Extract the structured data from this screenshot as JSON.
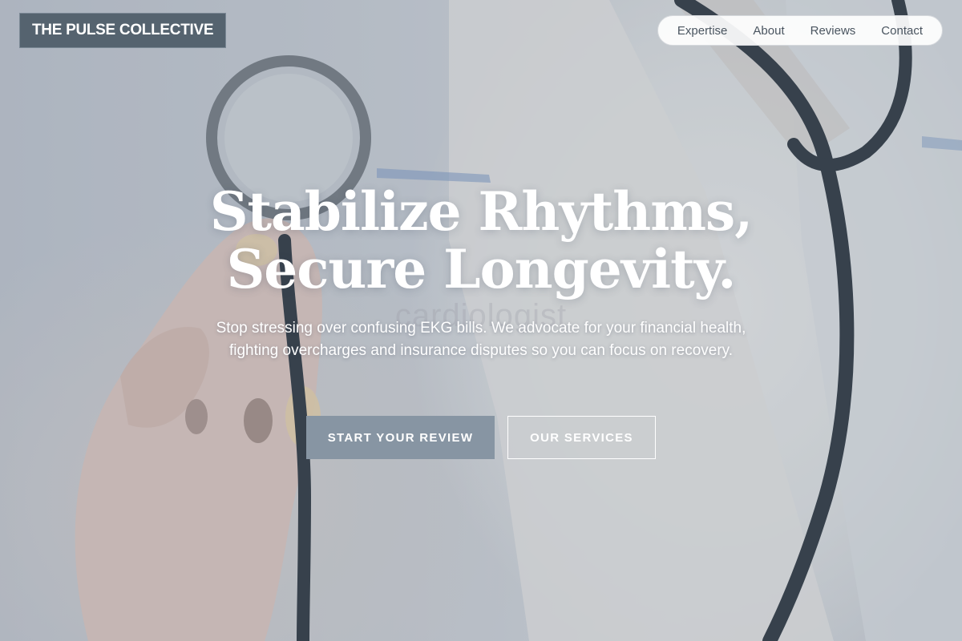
{
  "header": {
    "logo_text": "THE PULSE COLLECTIVE",
    "nav": [
      {
        "label": "Expertise"
      },
      {
        "label": "About"
      },
      {
        "label": "Reviews"
      },
      {
        "label": "Contact"
      }
    ]
  },
  "hero": {
    "headline_line1": "Stabilize Rhythms,",
    "headline_line2": "Secure Longevity.",
    "background_watermark": "cardiologist",
    "subtext": "Stop stressing over confusing EKG bills. We advocate for your financial health, fighting overcharges and insurance disputes so you can focus on recovery.",
    "primary_button": "START YOUR REVIEW",
    "secondary_button": "OUR SERVICES",
    "background_image": "doctor-holding-stethoscope-photo"
  },
  "colors": {
    "logo_bg": "#55636f",
    "primary_button_bg": "#8795a3",
    "nav_bg": "#ffffff",
    "headline": "#ffffff"
  }
}
